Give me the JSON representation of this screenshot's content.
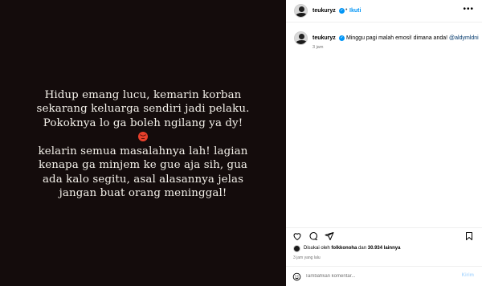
{
  "post": {
    "paragraph1": [
      "Hidup emang lucu, kemarin korban",
      "sekarang keluarga sendiri jadi pelaku.",
      "Pokoknya lo ga boleh ngilang ya dy!"
    ],
    "paragraph2": [
      "kelarin semua masalahnya lah! lagian",
      "kenapa ga minjem ke gue aja sih, gua",
      "ada kalo segitu, asal alasannya jelas",
      "jangan buat orang meninggal!"
    ]
  },
  "header": {
    "username": "teukuryz",
    "separator": "•",
    "follow_label": "Ikuti",
    "more": "•••"
  },
  "caption": {
    "username": "teukuryz",
    "text": "Minggu pagi malah emosi! dimana anda!",
    "mention": "@aldymldni",
    "time": "3 jam"
  },
  "likes": {
    "prefix": "Disukai oleh",
    "liker": "folkkonoha",
    "middle": "dan",
    "count": "30.934 lainnya"
  },
  "posted_time": "3 jam yang lalu",
  "comment": {
    "placeholder": "Tambahkan komentar...",
    "post_label": "Kirim"
  },
  "icons": [
    "verified-icon",
    "more-icon",
    "heart-icon",
    "comment-icon",
    "share-icon",
    "bookmark-icon",
    "emoji-icon",
    "angry-face-icon"
  ],
  "colors": {
    "image_bg": "#140c0c",
    "image_text": "#f4f1ea",
    "accent": "#0095f6",
    "mention": "#00376b",
    "muted": "#737373"
  }
}
